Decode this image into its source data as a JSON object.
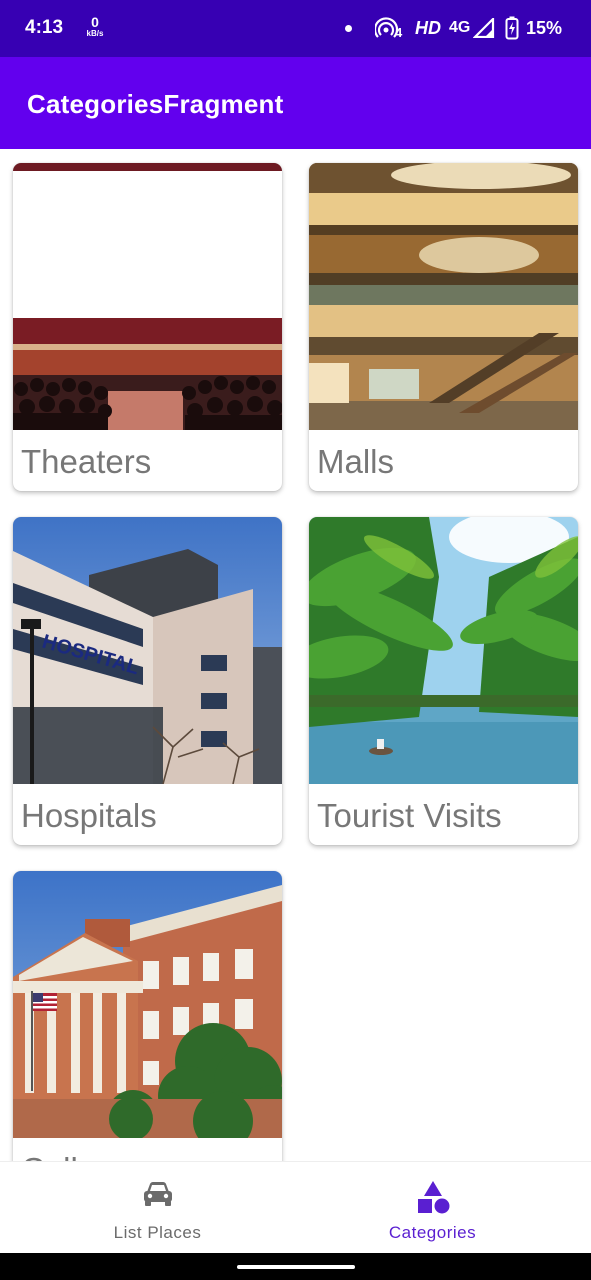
{
  "status_bar": {
    "time": "4:13",
    "net_speed": "0",
    "net_speed_unit": "kB/s",
    "hd": "HD",
    "network": "4G",
    "battery": "15%",
    "hotspot_count": "4",
    "icons": [
      "notification-dot-icon",
      "hotspot-icon",
      "signal-icon",
      "battery-charging-icon"
    ]
  },
  "app_bar": {
    "title": "CategoriesFragment"
  },
  "categories": [
    {
      "label": "Theaters",
      "image": "theater-auditorium"
    },
    {
      "label": "Malls",
      "image": "mall-interior"
    },
    {
      "label": "Hospitals",
      "image": "hospital-building"
    },
    {
      "label": "Tourist Visits",
      "image": "tropical-backwaters"
    },
    {
      "label": "Colleges",
      "image": "college-building"
    }
  ],
  "bottom_nav": {
    "items": [
      {
        "label": "List Places",
        "icon": "car-icon",
        "selected": false
      },
      {
        "label": "Categories",
        "icon": "categories-shapes-icon",
        "selected": true
      }
    ]
  },
  "colors": {
    "status_bar": "#3700b3",
    "app_bar": "#6200ee",
    "accent": "#5a1fd1",
    "label_text": "#777777"
  }
}
